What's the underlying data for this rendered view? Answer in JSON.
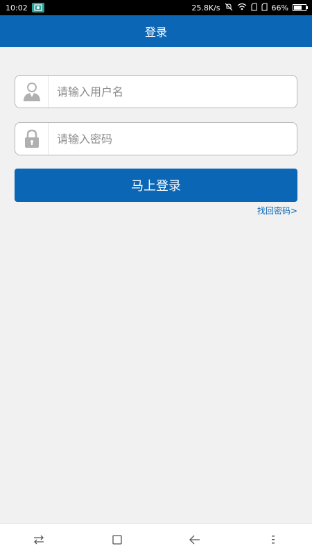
{
  "status": {
    "time": "10:02",
    "network_speed": "25.8K/s",
    "battery_percent": "66%",
    "battery_level": 0.66
  },
  "header": {
    "title": "登录"
  },
  "form": {
    "username_placeholder": "请输入用户名",
    "password_placeholder": "请输入密码",
    "login_label": "马上登录",
    "recover_label": "找回密码>"
  },
  "icons": {
    "user": "user-icon",
    "lock": "lock-icon",
    "switch": "switch-apps-icon",
    "home": "home-square-icon",
    "back": "back-arrow-icon",
    "menu": "menu-icon"
  },
  "colors": {
    "primary": "#0c66b6",
    "background": "#f1f1f1",
    "border": "#b7b7b7"
  }
}
